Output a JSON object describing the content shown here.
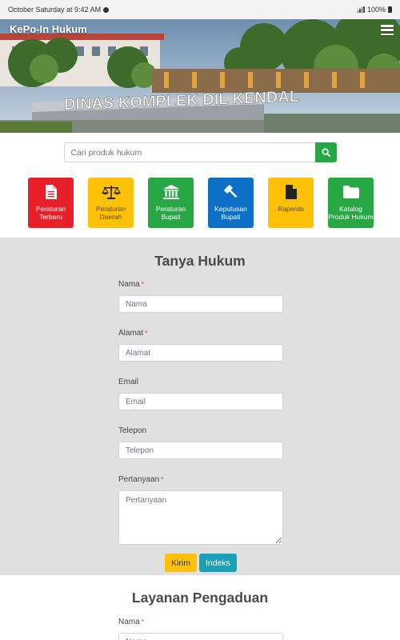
{
  "status_bar": {
    "left_text": "October Saturday at 9:42 AM",
    "battery": "100%"
  },
  "header": {
    "brand": "KePo-In Hukum",
    "sign_text": "DINAS KOMPLEK DIL KENDAL",
    "menu_icon": "hamburger-icon"
  },
  "search": {
    "placeholder": "Cari produk hukum",
    "icon": "search-icon"
  },
  "categories": [
    {
      "label": "Peraturan Terbaru",
      "line1": "Peraturan",
      "line2": "Terbaru",
      "color": "#e8202a",
      "icon": "document-icon"
    },
    {
      "label": "Peraturan Daerah",
      "line1": "Peraturan",
      "line2": "Daerah",
      "color": "#ffc107",
      "icon": "scales-icon"
    },
    {
      "label": "Peraturan Bupati",
      "line1": "Peraturan",
      "line2": "Bupati",
      "color": "#28a745",
      "icon": "institution-icon"
    },
    {
      "label": "Keputusan Bupati",
      "line1": "Keputusan",
      "line2": "Bupati",
      "color": "#0d6fc5",
      "icon": "gavel-icon"
    },
    {
      "label": "Raperda",
      "line1": "Raperda",
      "line2": "",
      "color": "#ffc107",
      "icon": "file-icon"
    },
    {
      "label": "Katalog Produk Hukum",
      "line1": "Katalog",
      "line2": "Produk Hukum",
      "color": "#28a745",
      "icon": "folder-icon"
    }
  ],
  "tanya_hukum": {
    "title": "Tanya Hukum",
    "fields": [
      {
        "label": "Nama",
        "placeholder": "Nama",
        "required": true
      },
      {
        "label": "Alamat",
        "placeholder": "Alamat",
        "required": true
      },
      {
        "label": "Email",
        "placeholder": "Email",
        "required": false
      },
      {
        "label": "Telepon",
        "placeholder": "Telepon",
        "required": false
      },
      {
        "label": "Pertanyaan",
        "placeholder": "Pertanyaan",
        "required": true
      }
    ],
    "submit_label": "Kirim",
    "index_label": "Indeks"
  },
  "layanan_pengaduan": {
    "title": "Layanan Pengaduan",
    "first_field_label": "Nama",
    "first_field_placeholder": "Nama"
  },
  "colors": {
    "green": "#28a745",
    "yellow": "#ffc107",
    "teal": "#17a2b8",
    "red": "#e8202a",
    "blue": "#0d6fc5",
    "section_bg": "#e0e0e0"
  }
}
